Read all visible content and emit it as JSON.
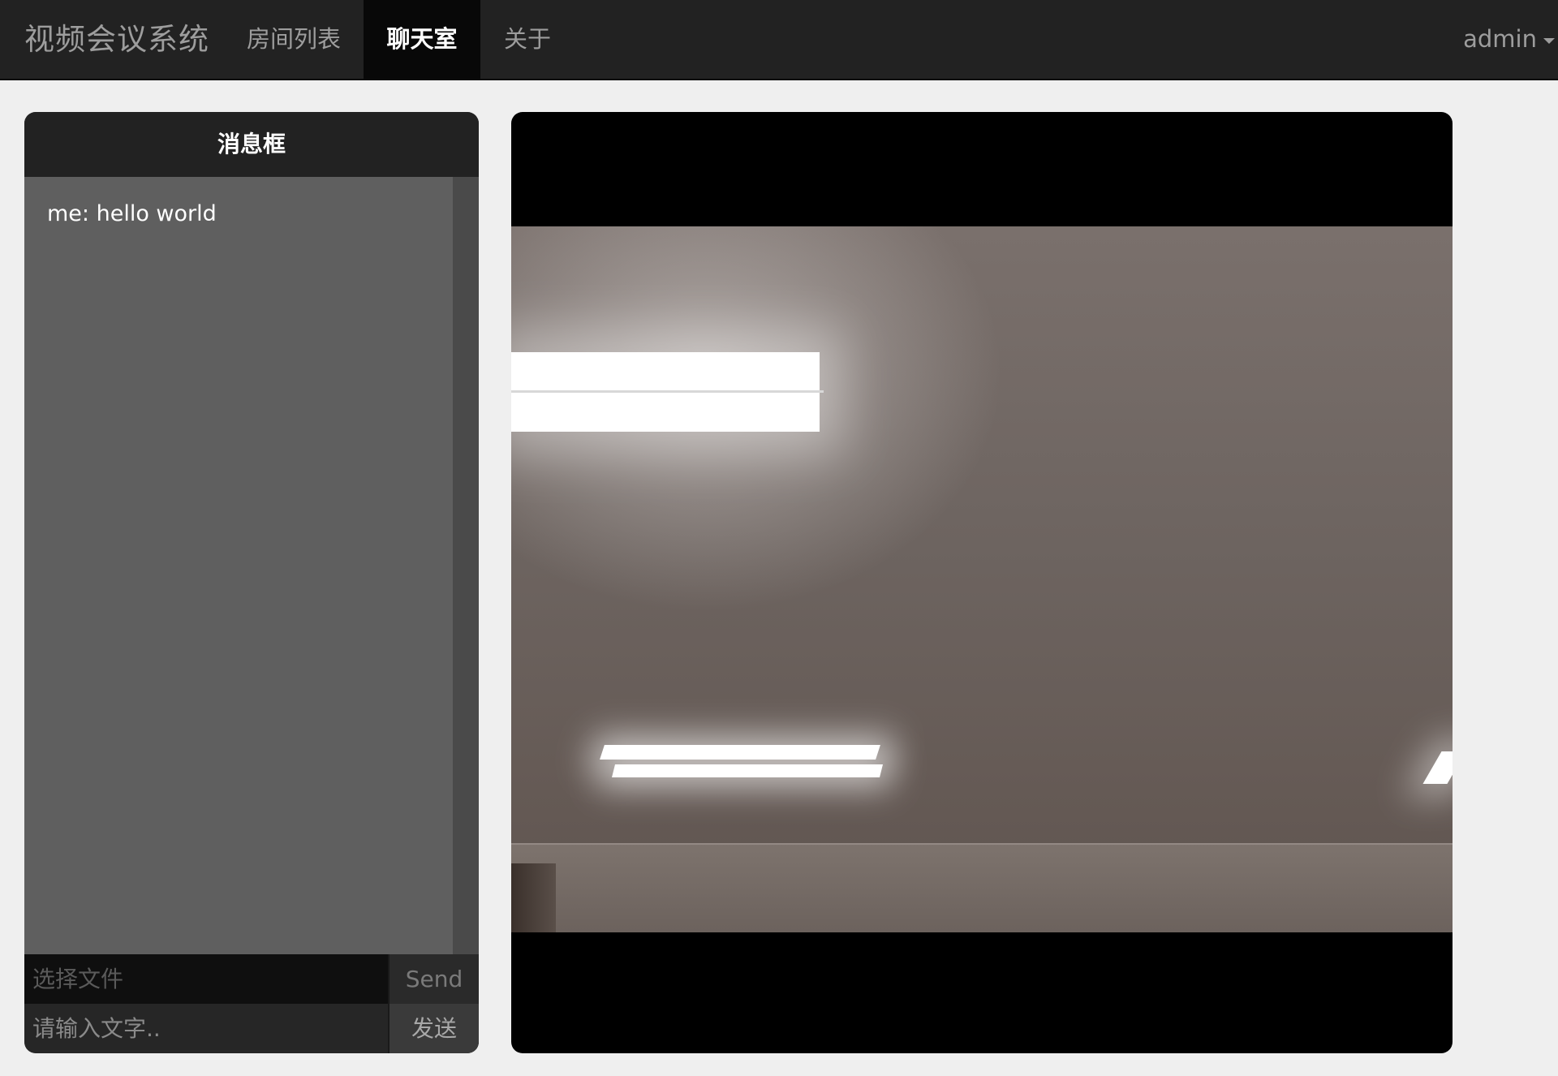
{
  "navbar": {
    "brand": "视频会议系统",
    "items": [
      {
        "label": "房间列表",
        "active": false
      },
      {
        "label": "聊天室",
        "active": true
      },
      {
        "label": "关于",
        "active": false
      }
    ],
    "user": "admin"
  },
  "chat": {
    "title": "消息框",
    "messages": [
      {
        "text": "me: hello world"
      }
    ],
    "file_input": {
      "placeholder": "选择文件",
      "button_label": "Send"
    },
    "text_input": {
      "placeholder": "请输入文字..",
      "button_label": "发送"
    }
  },
  "video": {
    "stream_description": "camera-feed"
  },
  "colors": {
    "navbar_bg": "#222222",
    "active_nav_bg": "#080808",
    "page_bg": "#efefef",
    "chat_bg": "#5f5f5f",
    "video_bg": "#000000"
  }
}
